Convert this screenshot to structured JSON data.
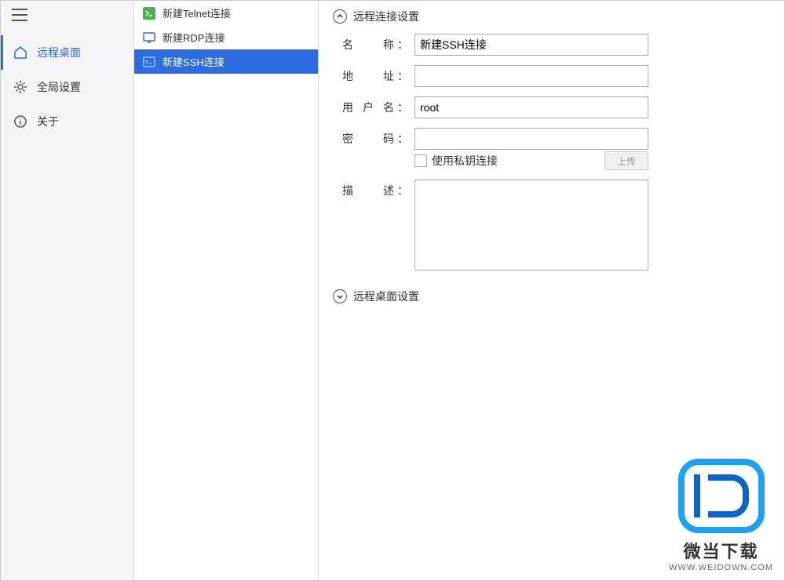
{
  "sidebar": {
    "items": [
      {
        "label": "远程桌面"
      },
      {
        "label": "全局设置"
      },
      {
        "label": "关于"
      }
    ]
  },
  "connections": [
    {
      "label": "新建Telnet连接"
    },
    {
      "label": "新建RDP连接"
    },
    {
      "label": "新建SSH连接"
    }
  ],
  "detail": {
    "section1_title": "远程连接设置",
    "section2_title": "远程桌面设置",
    "name_label": "名 称",
    "name_value": "新建SSH连接",
    "addr_label": "地 址",
    "addr_value": "",
    "user_label": "用户名",
    "user_value": "root",
    "pass_label": "密 码",
    "pass_value": "",
    "desc_label": "描 述",
    "desc_value": "",
    "key_label": "使用私钥连接",
    "upload_label": "上传"
  },
  "watermark": {
    "title": "微当下载",
    "url": "WWW.WEIDOWN.COM"
  }
}
